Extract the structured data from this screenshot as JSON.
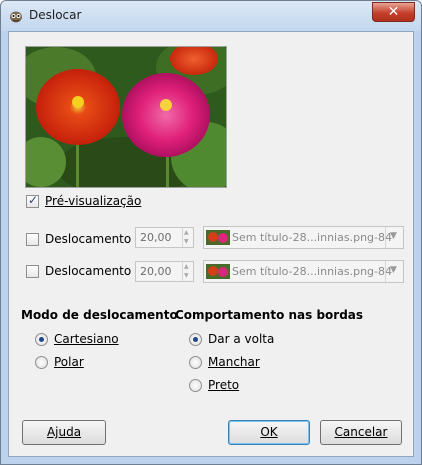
{
  "window": {
    "title": "Deslocar",
    "close_label": "✕",
    "app_icon": "gimp-icon"
  },
  "preview_checkbox": {
    "label": "Pré-visualização",
    "checked": true
  },
  "offset_x": {
    "label_prefix": "Deslocamento ",
    "label_key": "x",
    "checked": false,
    "value": "20,00",
    "drawable": "Sem título-28...innias.png-84"
  },
  "offset_y": {
    "label_prefix": "Deslocamento ",
    "label_key": "y",
    "checked": false,
    "value": "20,00",
    "drawable": "Sem título-28...innias.png-84"
  },
  "mode": {
    "heading": "Modo de deslocamento",
    "options": [
      {
        "label": "Cartesiano",
        "selected": true
      },
      {
        "label": "Polar",
        "selected": false
      }
    ]
  },
  "edge": {
    "heading": "Comportamento nas bordas",
    "options": [
      {
        "label": "Dar a volta",
        "selected": true
      },
      {
        "label": "Manchar",
        "selected": false
      },
      {
        "label": "Preto",
        "selected": false
      }
    ]
  },
  "buttons": {
    "help": "Ajuda",
    "ok": "OK",
    "cancel": "Cancelar"
  },
  "colors": {
    "title_bar": "#c3d7ee",
    "dialog_bg": "#f0f0f0",
    "close_red": "#c4402c",
    "default_button_border": "#3c7fb1"
  }
}
